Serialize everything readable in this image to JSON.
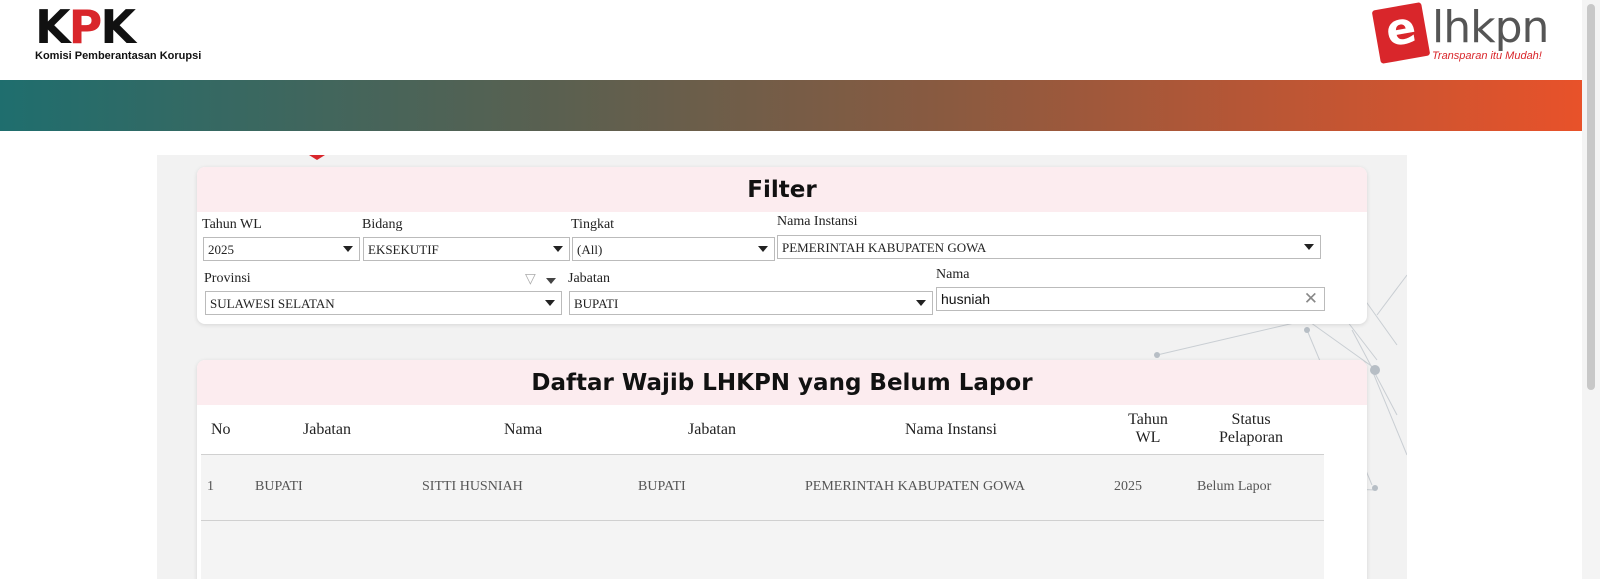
{
  "header": {
    "kpk_logo_text": "KPK",
    "kpk_subtitle": "Komisi Pemberantasan Korupsi",
    "elhkpn_e": "e",
    "elhkpn_name": "lhkpn",
    "elhkpn_tagline": "Transparan itu Mudah!",
    "gradient_colors": [
      "#1f6e6e",
      "#e8522a"
    ]
  },
  "filter": {
    "title": "Filter",
    "tahun_wl": {
      "label": "Tahun WL",
      "value": "2025"
    },
    "bidang": {
      "label": "Bidang",
      "value": "EKSEKUTIF"
    },
    "tingkat": {
      "label": "Tingkat",
      "value": "(All)"
    },
    "nama_instansi": {
      "label": "Nama Instansi",
      "value": "PEMERINTAH KABUPATEN GOWA"
    },
    "provinsi": {
      "label": "Provinsi",
      "value": "SULAWESI SELATAN"
    },
    "jabatan": {
      "label": "Jabatan",
      "value": "BUPATI"
    },
    "nama": {
      "label": "Nama",
      "value": "husniah"
    }
  },
  "list": {
    "title": "Daftar Wajib LHKPN yang Belum Lapor",
    "columns": [
      "No",
      "Jabatan",
      "Nama",
      "Jabatan",
      "Nama Instansi",
      "Tahun WL",
      "Status Pelaporan"
    ],
    "rows": [
      {
        "no": "1",
        "jabatan1": "BUPATI",
        "nama": "SITTI HUSNIAH",
        "jabatan2": "BUPATI",
        "instansi": "PEMERINTAH KABUPATEN GOWA",
        "tahun": "2025",
        "status": "Belum Lapor"
      }
    ]
  }
}
